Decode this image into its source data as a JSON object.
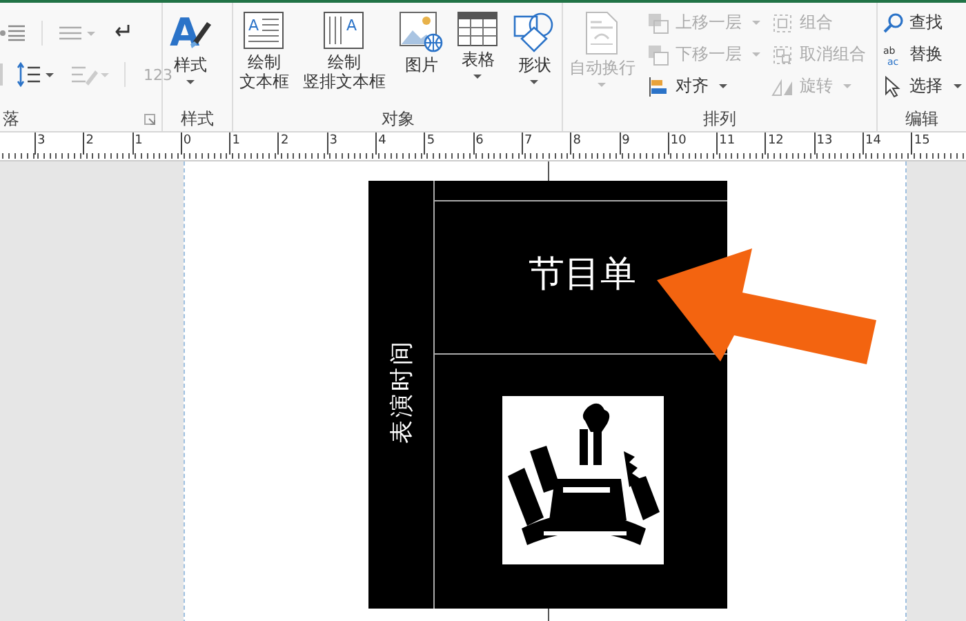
{
  "ribbon": {
    "groups": [
      {
        "label": "落",
        "items": [
          {
            "lines": [
              "123"
            ],
            "caret": false,
            "disabled": true
          }
        ]
      },
      {
        "label": "样式",
        "items": [
          {
            "lines": [
              "样式"
            ],
            "icon_text": "A",
            "caret": true,
            "disabled": false
          }
        ]
      },
      {
        "label": "对象",
        "items": [
          {
            "lines": [
              "绘制",
              "文本框"
            ],
            "icon_text": "A",
            "caret": false,
            "disabled": false
          },
          {
            "lines": [
              "绘制",
              "竖排文本框"
            ],
            "icon_text": "A",
            "caret": false,
            "disabled": false
          },
          {
            "lines": [
              "图片"
            ],
            "caret": false,
            "disabled": false
          },
          {
            "lines": [
              "表格"
            ],
            "caret": true,
            "disabled": false
          },
          {
            "lines": [
              "形状"
            ],
            "caret": true,
            "disabled": false
          }
        ]
      },
      {
        "label": "排列",
        "items": [
          {
            "lines": [
              "自动换行"
            ],
            "caret": true,
            "disabled": true
          },
          {
            "lines": [
              "上移一层"
            ],
            "caret": true,
            "disabled": true
          },
          {
            "lines": [
              "下移一层"
            ],
            "caret": true,
            "disabled": true
          },
          {
            "lines": [
              "对齐"
            ],
            "caret": true,
            "disabled": false
          },
          {
            "lines": [
              "组合"
            ],
            "caret": false,
            "disabled": true
          },
          {
            "lines": [
              "取消组合"
            ],
            "caret": false,
            "disabled": true
          },
          {
            "lines": [
              "旋转"
            ],
            "caret": true,
            "disabled": true
          }
        ]
      },
      {
        "label": "编辑",
        "items": [
          {
            "lines": [
              "查找"
            ],
            "caret": false,
            "disabled": false
          },
          {
            "lines": [
              "替换"
            ],
            "icon_text": "ab",
            "icon_text_2": "ac",
            "caret": false,
            "disabled": false
          },
          {
            "lines": [
              "选择"
            ],
            "caret": true,
            "disabled": false
          }
        ]
      }
    ]
  },
  "ruler": {
    "labels": [
      "3",
      "2",
      "1",
      "0",
      "1",
      "2",
      "3",
      "4",
      "5",
      "6",
      "7",
      "8",
      "9",
      "10",
      "11",
      "12",
      "13",
      "14",
      "15"
    ]
  },
  "page": {
    "title": "节目单",
    "side_text": "表演时间"
  }
}
